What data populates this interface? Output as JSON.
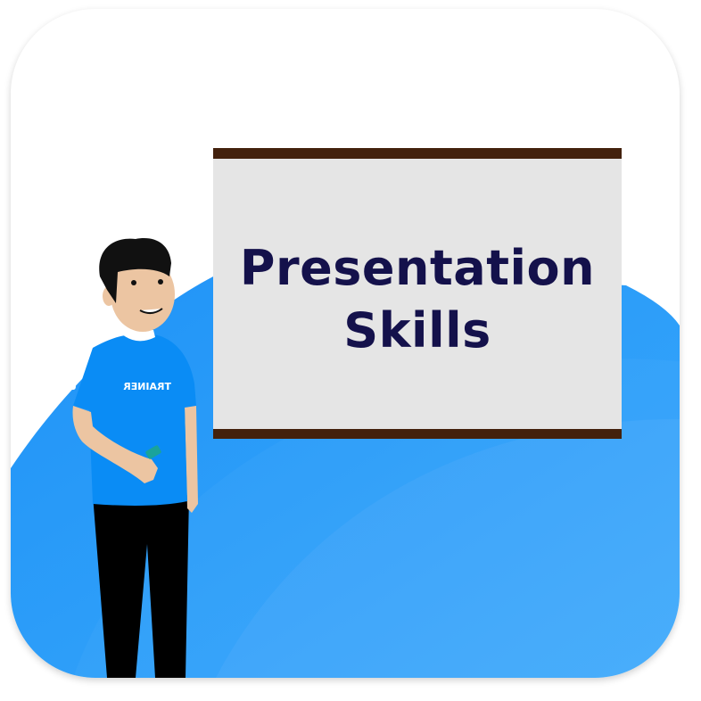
{
  "board": {
    "title_line1": "Presentation",
    "title_line2": "Skills"
  },
  "character": {
    "shirt_logo": "TRAINER"
  },
  "colors": {
    "background_blue": "#2499f7",
    "board_fill": "#e5e5e5",
    "board_bars": "#43210d",
    "title_text": "#14114b",
    "shirt": "#0a8cf5",
    "pants": "#000000",
    "skin": "#ecc5a2"
  }
}
